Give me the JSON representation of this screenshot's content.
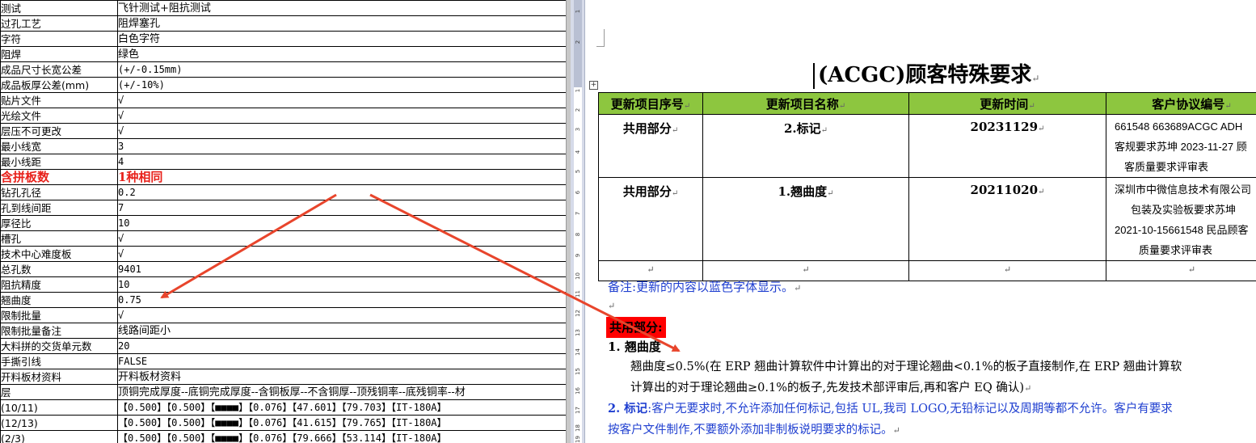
{
  "spreadsheet": {
    "rows": [
      {
        "label": "测试",
        "value": "飞针测试+阻抗测试"
      },
      {
        "label": "过孔工艺",
        "value": "阻焊塞孔"
      },
      {
        "label": "字符",
        "value": "白色字符"
      },
      {
        "label": "阻焊",
        "value": "绿色"
      },
      {
        "label": "成品尺寸长宽公差",
        "value": "(+/-0.15mm)"
      },
      {
        "label": "成品板厚公差(mm)",
        "value": "(+/-10%)"
      },
      {
        "label": "贴片文件",
        "value": "√"
      },
      {
        "label": "光绘文件",
        "value": "√"
      },
      {
        "label": "层压不可更改",
        "value": "√"
      },
      {
        "label": "最小线宽",
        "value": "3"
      },
      {
        "label": "最小线距",
        "value": "4"
      },
      {
        "label": "含拼板数",
        "value": "1种相同"
      },
      {
        "label": "钻孔孔径",
        "value": "0.2"
      },
      {
        "label": "孔到线间距",
        "value": "7"
      },
      {
        "label": "厚径比",
        "value": "10"
      },
      {
        "label": "槽孔",
        "value": "√"
      },
      {
        "label": "技术中心难度板",
        "value": "√"
      },
      {
        "label": "总孔数",
        "value": "9401"
      },
      {
        "label": "阻抗精度",
        "value": "10"
      },
      {
        "label": "翘曲度",
        "value": "0.75"
      },
      {
        "label": "限制批量",
        "value": "√"
      },
      {
        "label": "限制批量备注",
        "value": "线路间距小"
      },
      {
        "label": "大料拼的交货单元数",
        "value": "20"
      },
      {
        "label": "手撕引线",
        "value": "FALSE"
      },
      {
        "label": "开料板材资料",
        "value": "开料板材资料"
      },
      {
        "label": "层",
        "value": "顶铜完成厚度--底铜完成厚度--含铜板厚--不含铜厚--顶残铜率--底残铜率--材"
      },
      {
        "label": "(10/11)",
        "value": "【0.500】【0.500】【■■■■】【0.076】【47.601】【79.703】【IT-180A】"
      },
      {
        "label": "(12/13)",
        "value": "【0.500】【0.500】【■■■■】【0.076】【41.615】【79.765】【IT-180A】"
      },
      {
        "label": "(2/3)",
        "value": "【0.500】【0.500】【■■■■】【0.076】【79.666】【53.114】【IT-180A】"
      }
    ],
    "highlight_color": "#e8211b"
  },
  "ruler": {
    "ticks": [
      "1",
      "2",
      "1",
      "2",
      "3",
      "4",
      "5",
      "6",
      "7",
      "8",
      "9",
      "10",
      "11",
      "12",
      "13",
      "14",
      "15",
      "16",
      "17",
      "18",
      "19"
    ]
  },
  "document": {
    "title": "(ACGC)顾客特殊要求",
    "para_mark": "↵",
    "table": {
      "headers": [
        "更新项目序号",
        "更新项目名称",
        "更新时间",
        "客户协议编号"
      ],
      "rows": [
        {
          "seq": "共用部分",
          "name": "2.标记",
          "date": "20231129",
          "agreement": [
            "661548 663689ACGC ADH",
            "客规要求苏坤 2023-11-27 顾",
            "客质量要求评审表"
          ]
        },
        {
          "seq": "共用部分",
          "name": "1.翘曲度",
          "date": "20211020",
          "agreement": [
            "深圳市中微信息技术有限公司",
            "包装及实验板要求苏坤",
            "2021-10-15661548 民品顾客",
            "质量要求评审表"
          ]
        }
      ],
      "header_color": "#8dc63f"
    },
    "note": "备注:更新的内容以蓝色字体显示。",
    "shared_heading": "共用部分:",
    "item1_title": "1.   翘曲度",
    "item1_body1": "翘曲度≤0.5%(在 ERP 翘曲计算软件中计算出的对于理论翘曲<0.1%的板子直接制作,在 ERP 翘曲计算软",
    "item1_body2": "计算出的对于理论翘曲≥0.1%的板子,先发技术部评审后,再和客户 EQ 确认)",
    "item2_label": "2. 标记",
    "item2_line1": ":客户无要求时,不允许添加任何标记,包括 UL,我司 LOGO,无铅标记以及周期等都不允许。客户有要求",
    "item2_line2": "按客户文件制作,不要额外添加非制板说明要求的标记。",
    "text_blue": "#1f3fd0",
    "heading_bg": "#ff0000"
  },
  "annotation": {
    "arrow_color": "#e8452c"
  }
}
